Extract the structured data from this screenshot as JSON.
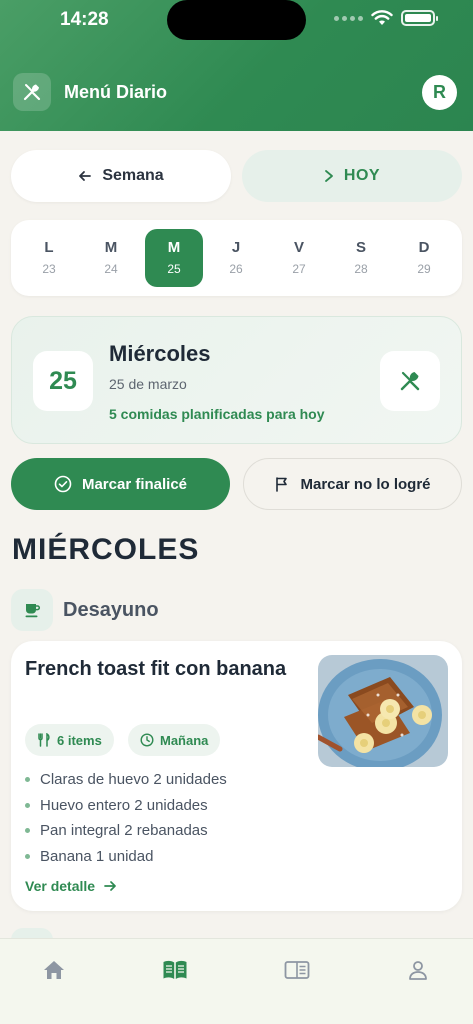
{
  "status_bar": {
    "time": "14:28"
  },
  "header": {
    "title": "Menú Diario",
    "avatar_initial": "R"
  },
  "nav": {
    "week_label": "Semana",
    "today_label": "HOY"
  },
  "week_days": [
    {
      "letter": "L",
      "number": "23",
      "active": false
    },
    {
      "letter": "M",
      "number": "24",
      "active": false
    },
    {
      "letter": "M",
      "number": "25",
      "active": true
    },
    {
      "letter": "J",
      "number": "26",
      "active": false
    },
    {
      "letter": "V",
      "number": "27",
      "active": false
    },
    {
      "letter": "S",
      "number": "28",
      "active": false
    },
    {
      "letter": "D",
      "number": "29",
      "active": false
    }
  ],
  "summary": {
    "day_number": "25",
    "day_name": "Miércoles",
    "date_text": "25 de marzo",
    "meals_text": "5 comidas planificadas para hoy"
  },
  "actions": {
    "done_label": "Marcar finalicé",
    "fail_label": "Marcar no lo logré"
  },
  "day_heading": "MIÉRCOLES",
  "meal_section": {
    "title": "Desayuno"
  },
  "meal_card": {
    "title": "French toast fit con banana",
    "items_chip": "6 items",
    "time_chip": "Mañana",
    "ingredients": [
      "Claras de huevo 2 unidades",
      "Huevo entero 2 unidades",
      "Pan integral 2 rebanadas",
      "Banana 1 unidad"
    ],
    "link_label": "Ver detalle"
  },
  "colors": {
    "primary": "#2f8a52",
    "primary_light": "#e6f0ea",
    "background": "#f5f3ee"
  },
  "tabbar": {
    "icons": [
      "home-icon",
      "menu-book-icon",
      "reader-icon",
      "profile-icon"
    ],
    "active_index": 1
  }
}
